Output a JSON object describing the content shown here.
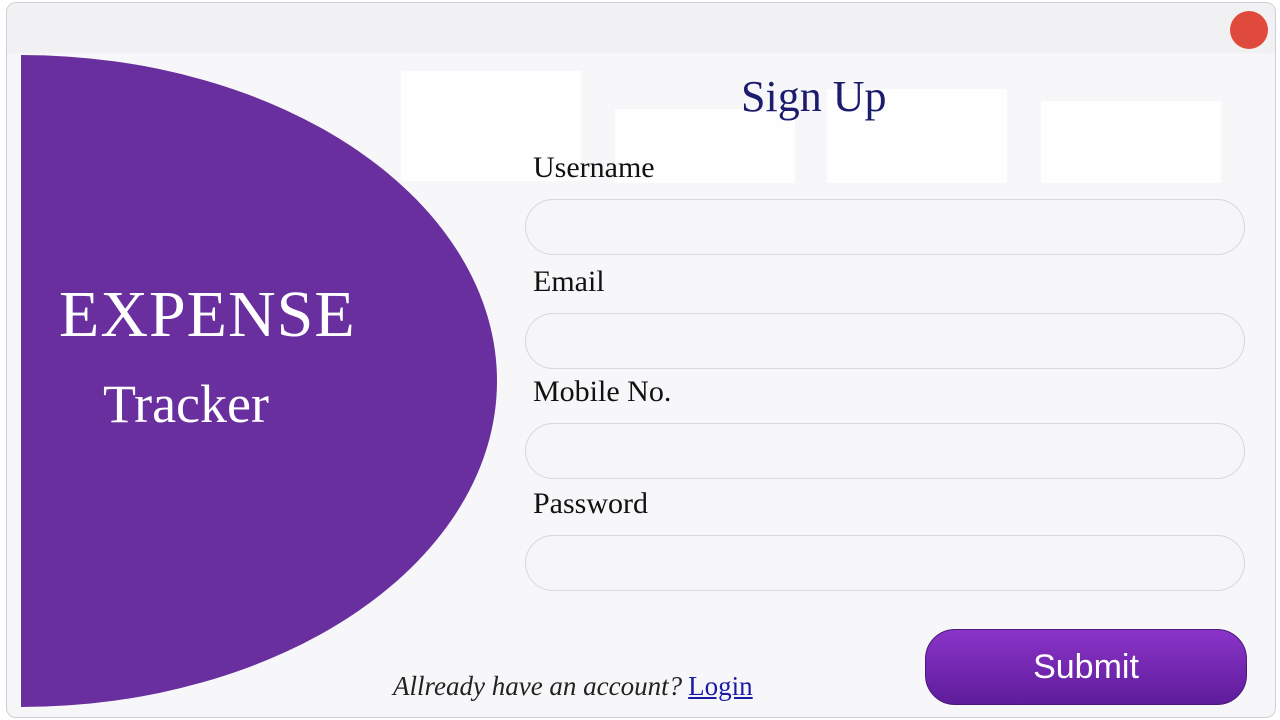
{
  "brand": {
    "title": "EXPENSE",
    "subtitle": "Tracker"
  },
  "form": {
    "title": "Sign Up",
    "fields": [
      {
        "label": "Username",
        "value": "",
        "placeholder": ""
      },
      {
        "label": "Email",
        "value": "",
        "placeholder": ""
      },
      {
        "label": "Mobile No.",
        "value": "",
        "placeholder": ""
      },
      {
        "label": "Password",
        "value": "",
        "placeholder": ""
      }
    ],
    "submit_label": "Submit",
    "login_prompt": "Allready have an account?",
    "login_link": "Login"
  },
  "colors": {
    "brand_panel": "#6a2f9e",
    "title_text": "#1c1c6e",
    "submit_gradient_top": "#8a34c8",
    "submit_gradient_bottom": "#5e1c9a",
    "close_button": "#e04a3d",
    "link": "#1a1aa8"
  },
  "icons": {
    "close": "close-icon"
  }
}
